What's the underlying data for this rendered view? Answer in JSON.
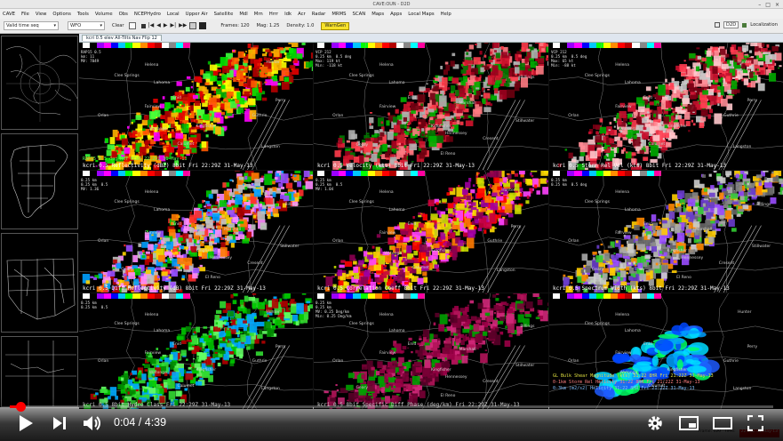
{
  "window": {
    "title": "CAVE:OUN - D2D"
  },
  "menu": [
    "CAVE",
    "File",
    "View",
    "Options",
    "Tools",
    "Volume",
    "Obs",
    "NCEPHydro",
    "Local",
    "Upper Air",
    "Satellite",
    "Mdl",
    "Mrn",
    "Hrrr",
    "Idk",
    "Acr",
    "Radar",
    "MRMS",
    "SCAN",
    "Maps",
    "Apps",
    "Local Maps",
    "Help"
  ],
  "toolbar": {
    "valid_time": "Valid time seq",
    "wfo": "WFO",
    "clear": "Clear",
    "frames": "Frames: 120",
    "mag": "Mag: 1.25",
    "density": "Density: 1.0",
    "warngen": "WarnGen",
    "d2d": "D2D",
    "localization": "Localization"
  },
  "editor_tab": "kcri 0.5 elev All-Tilts Nav Flip 12",
  "colors": {
    "accent_red": "#ff0000",
    "warngen_yellow": "#f7e22a",
    "map_line": "#9a9a9a"
  },
  "panels": [
    {
      "info": "RAP15 0.5\nkm: 11\nMV: 7049\n",
      "label": "kcri 0.5 Reflectivity (dBZ) 8bit  Fri 22:29Z 31-May-13",
      "top_label": "RAP15 0.5 deg Ref KCRI 22:29Z 31-May-13",
      "style": "reflectivity"
    },
    {
      "info": "VCP 212\n0.25 km  0.5 deg\nMax: 119 kt\nMin: -118 kt",
      "label": "kcri 0.5 Velocity (kts) 8bit  Fri 22:29Z 31-May-13",
      "style": "velocity"
    },
    {
      "info": "VCP 212\n0.25 km  0.5 deg\nMax: 65 kt\nMin: -88 kt",
      "label": "kcri 0.5 Storm Rel Vel (kts) 8bit  Fri 22:29Z 31-May-13",
      "style": "srv"
    },
    {
      "info": "0.25 km\n0.25 km  0.5\nMV: 1.36",
      "label": "kcri 0.5 Diff Reflectivity (dB) 8bit  Fri 22:29Z 31-May-13",
      "style": "zdr"
    },
    {
      "info": "0.25 km\n0.25 km  0.5\nMV: 1.04",
      "label": "kcri 0.5 Correlation Coeff 8bit  Fri 22:29Z 31-May-13",
      "style": "cc"
    },
    {
      "info": "0.25 km\n0.25 km  0.5 deg",
      "label": "kcri 0.5 Spectrum Width (kts) 8bit  Fri 22:29Z 31-May-13",
      "style": "sw"
    },
    {
      "info": "0.25 km\n0.25 km  0.5",
      "label": "kcri 0.5 8bit Hydro Class  Fri 22:29Z 31-May-13",
      "style": "hc"
    },
    {
      "info": "0.25 km\n0.25 km\nMV: 0.25 Deg/km\nMin: 0.25 Deg/km",
      "label": "kcri 0.5 8bit Specific Diff Phase (deg/km) Fri 22:29Z 31-May-13",
      "style": "kdp"
    },
    {
      "info": "",
      "label": "",
      "overlay": [
        "GL Bulk Shear Magnitude (kts)  31:22   8HR Fri 21:22Z 31-May-13",
        "0-1km  Storm Rel Helicity  31:22   8HR Fri 21:22Z 31-May-13",
        "0-3km  (m2/s2) Helicity  31:22    8HR Fri 21:22Z 31-May-13"
      ],
      "style": "shear"
    }
  ],
  "cities": [
    "Helena",
    "Clee Springs",
    "Lahoma",
    "Enid",
    "Fairview",
    "Orlan",
    "Kingfisher",
    "Marshall",
    "Guthrie",
    "Cresent",
    "Langston",
    "Hennessey",
    "Perry",
    "Stillwater",
    "Hunter",
    "Billings",
    "Watonga",
    "Geary",
    "Calumet",
    "El Reno"
  ],
  "status": {
    "frames": "Frame: 120",
    "time": "Time:",
    "time_value": "22:29Z 31-May-13"
  },
  "player": {
    "current_time": "0:04",
    "duration": "4:39",
    "time_display": "0:04 / 4:39",
    "progress": 0.0143
  }
}
